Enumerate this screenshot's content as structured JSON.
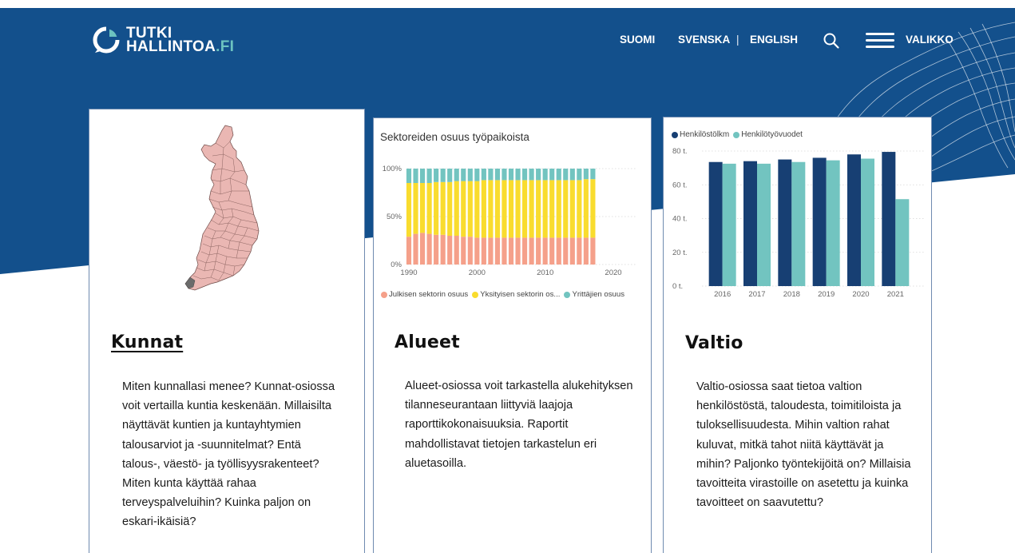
{
  "header": {
    "logo": {
      "line1": "TUTKI",
      "line2_main": "HALLINTOA",
      "line2_suffix": ".FI"
    },
    "nav": {
      "lang_fi": "SUOMI",
      "lang_sv": "SVENSKA",
      "separator": "|",
      "lang_en": "ENGLISH",
      "menu_label": "VALIKKO",
      "search_icon": "search-icon",
      "menu_icon": "hamburger-icon"
    }
  },
  "colors": {
    "hero_blue": "#13508c",
    "navy": "#173f73",
    "teal": "#72c4c0",
    "salmon": "#f5a08a",
    "yellow": "#f9dc2e",
    "logo_accent": "#6cc3c0",
    "map_fill": "#eab7b3"
  },
  "cards": [
    {
      "title": "Kunnat",
      "text": "Miten kunnallasi menee? Kunnat-osiossa voit vertailla kuntia keskenään. Millaisilta näyttävät kuntien ja kuntayhtymien talousarviot ja -suunnitelmat? Entä talous-, väestö- ja työllisyysrakenteet? Miten kunta käyttää rahaa terveyspalveluihin? Kuinka paljon on eskari-ikäisiä?"
    },
    {
      "title": "Alueet",
      "text": "Alueet-osiossa voit tarkastella alukehityksen tilanneseurantaan liittyviä laajoja raporttikokonaisuuksia. Raportit mahdollistavat tietojen tarkastelun eri aluetasoilla."
    },
    {
      "title": "Valtio",
      "text": "Valtio-osiossa saat tietoa valtion henkilöstöstä, taloudesta, toimitiloista ja tuloksellisuudesta. Mihin valtion rahat kuluvat, mitkä tahot niitä käyttävät ja mihin? Paljonko työntekijöitä on? Millaisia tavoitteita virastoille on asetettu ja kuinka tavoitteet on saavutettu?"
    }
  ],
  "chart_data": [
    {
      "type": "bar",
      "stacked": true,
      "title": "Sektoreiden osuus työpaikoista",
      "x": [
        1990,
        1991,
        1992,
        1993,
        1994,
        1995,
        1996,
        1997,
        1998,
        1999,
        2000,
        2001,
        2002,
        2003,
        2004,
        2005,
        2006,
        2007,
        2008,
        2009,
        2010,
        2011,
        2012,
        2013,
        2014,
        2015,
        2016,
        2017
      ],
      "x_ticks": [
        "1990",
        "2000",
        "2010",
        "2020"
      ],
      "xlim": [
        1990,
        2020
      ],
      "y_ticks": [
        "0%",
        "50%",
        "100%"
      ],
      "ylim": [
        0,
        100
      ],
      "legend_position": "bottom",
      "series": [
        {
          "name": "Julkisen sektorin osuus",
          "color": "#f5a08a",
          "values": [
            29,
            32,
            33,
            32,
            31,
            31,
            30,
            30,
            29,
            29,
            28,
            28,
            28,
            28,
            28,
            28,
            28,
            28,
            28,
            28,
            28,
            28,
            28,
            28,
            28,
            28,
            28,
            28
          ]
        },
        {
          "name": "Yksityisen sektorin os...",
          "color": "#f9dc2e",
          "values": [
            56,
            53,
            52,
            53,
            55,
            55,
            56,
            57,
            58,
            58,
            59,
            60,
            60,
            60,
            60,
            60,
            60,
            60,
            60,
            60,
            60,
            60,
            60,
            60,
            60,
            60,
            61,
            61
          ]
        },
        {
          "name": "Yrittäjien osuus",
          "color": "#72c4c0",
          "values": [
            15,
            15,
            15,
            15,
            14,
            14,
            14,
            13,
            13,
            13,
            13,
            12,
            12,
            12,
            12,
            12,
            12,
            12,
            12,
            12,
            12,
            12,
            12,
            12,
            12,
            12,
            11,
            11
          ]
        }
      ]
    },
    {
      "type": "bar",
      "categories": [
        "2016",
        "2017",
        "2018",
        "2019",
        "2020",
        "2021"
      ],
      "y_ticks": [
        "0 t.",
        "20 t.",
        "40 t.",
        "60 t.",
        "80 t."
      ],
      "ylim": [
        0,
        80
      ],
      "legend_position": "top-left",
      "series": [
        {
          "name": "Henkilöstölkm",
          "color": "#173f73",
          "values": [
            73.5,
            74,
            75,
            76,
            78,
            79.5
          ]
        },
        {
          "name": "Henkilötyövuodet",
          "color": "#72c4c0",
          "values": [
            72.5,
            72.5,
            73.5,
            74.5,
            75.5,
            51.5
          ]
        }
      ]
    }
  ]
}
